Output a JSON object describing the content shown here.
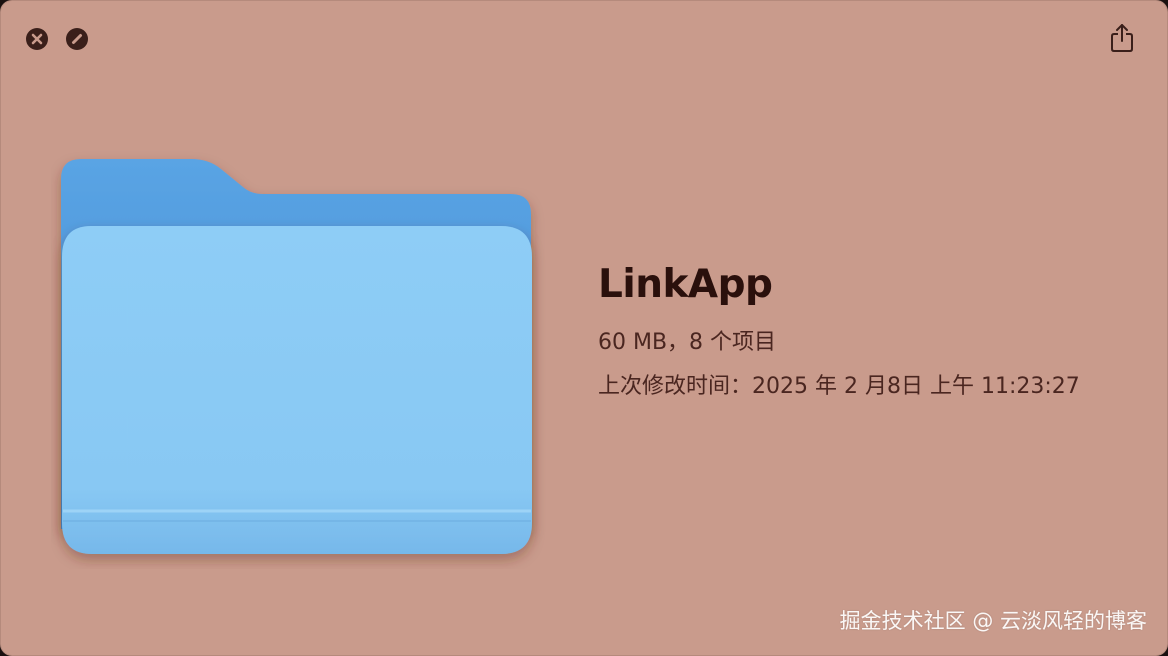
{
  "window": {
    "background": "#c99b8c"
  },
  "controls": {
    "close_icon": "close-x-icon",
    "fullscreen_icon": "slash-circle-icon",
    "share_icon": "share-icon"
  },
  "file": {
    "name": "LinkApp",
    "size_items": "60 MB，8 个项目",
    "modified": "上次修改时间：2025 年 2 月8日 上午 11:23:27",
    "icon": "folder-icon",
    "folder_color": "#8ccbf4"
  },
  "watermark": {
    "text": "掘金技术社区 @ 云淡风轻的博客"
  }
}
